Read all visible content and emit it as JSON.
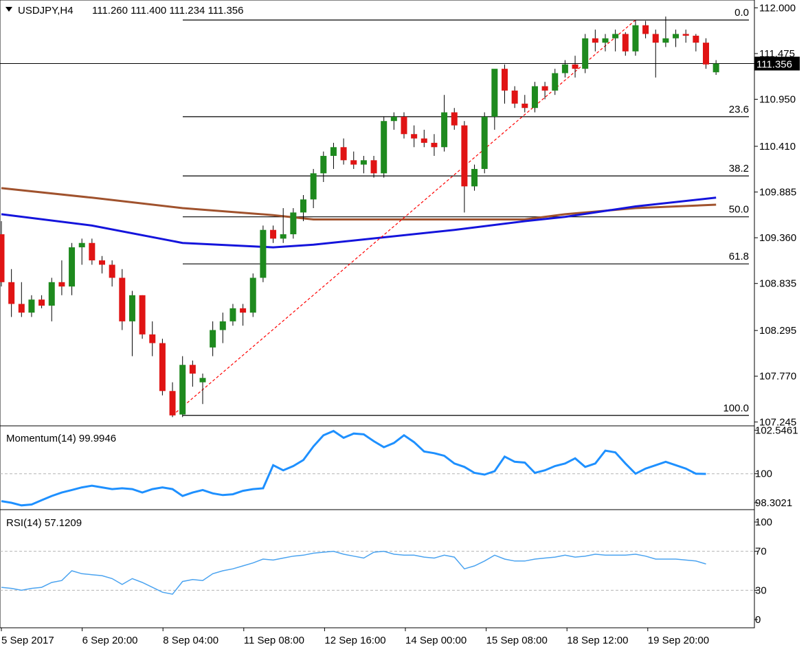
{
  "header": {
    "symbol": "USDJPY,H4",
    "ohlc": "111.260 111.400 111.234 111.356",
    "collapse_icon": "triangle-down-icon"
  },
  "colors": {
    "bull": "#1e8a1e",
    "bear": "#e01414",
    "wick": "#000000",
    "sma_slow": "#a0522d",
    "sma_fast": "#1414dc",
    "fib": "#000000",
    "trend": "#ff0000",
    "momentum": "#1e90ff",
    "rsi": "#4aa3f0",
    "level_line": "#b4b4b4"
  },
  "price_axis": {
    "ticks": [
      "112.000",
      "111.475",
      "110.950",
      "110.410",
      "109.885",
      "109.360",
      "108.835",
      "108.295",
      "107.770",
      "107.245"
    ],
    "current_price": "111.356"
  },
  "time_axis": {
    "labels": [
      "5 Sep 2017",
      "6 Sep 20:00",
      "8 Sep 04:00",
      "11 Sep 08:00",
      "12 Sep 16:00",
      "14 Sep 00:00",
      "15 Sep 08:00",
      "18 Sep 12:00",
      "19 Sep 20:00"
    ]
  },
  "momentum": {
    "title": "Momentum(14) 99.9946",
    "ticks": [
      "102.5461",
      "100",
      "98.3021"
    ]
  },
  "rsi": {
    "title": "RSI(14) 57.1209",
    "ticks": [
      "100",
      "70",
      "30",
      "0"
    ]
  },
  "chart_data": [
    {
      "type": "candlestick",
      "title": "USDJPY,H4",
      "ylim": [
        107.2,
        112.09
      ],
      "fib_levels": [
        {
          "label": "0.0",
          "price": 111.86
        },
        {
          "label": "23.6",
          "price": 110.75
        },
        {
          "label": "38.2",
          "price": 110.07
        },
        {
          "label": "50.0",
          "price": 109.6
        },
        {
          "label": "61.8",
          "price": 109.06
        },
        {
          "label": "100.0",
          "price": 107.32
        }
      ],
      "trendline": {
        "from": {
          "index": 17,
          "price": 107.32
        },
        "to": {
          "index": 63,
          "price": 111.86
        }
      },
      "candles": [
        {
          "o": 109.4,
          "h": 109.55,
          "l": 108.8,
          "c": 108.85
        },
        {
          "o": 108.85,
          "h": 109.0,
          "l": 108.45,
          "c": 108.6
        },
        {
          "o": 108.6,
          "h": 108.85,
          "l": 108.45,
          "c": 108.5
        },
        {
          "o": 108.5,
          "h": 108.7,
          "l": 108.45,
          "c": 108.65
        },
        {
          "o": 108.65,
          "h": 108.7,
          "l": 108.55,
          "c": 108.58
        },
        {
          "o": 108.58,
          "h": 108.9,
          "l": 108.4,
          "c": 108.85
        },
        {
          "o": 108.85,
          "h": 109.1,
          "l": 108.7,
          "c": 108.8
        },
        {
          "o": 108.8,
          "h": 109.3,
          "l": 108.7,
          "c": 109.25
        },
        {
          "o": 109.25,
          "h": 109.35,
          "l": 109.05,
          "c": 109.3
        },
        {
          "o": 109.3,
          "h": 109.35,
          "l": 109.05,
          "c": 109.1
        },
        {
          "o": 109.1,
          "h": 109.15,
          "l": 108.95,
          "c": 109.05
        },
        {
          "o": 109.05,
          "h": 109.1,
          "l": 108.8,
          "c": 108.9
        },
        {
          "o": 108.9,
          "h": 109.0,
          "l": 108.3,
          "c": 108.4
        },
        {
          "o": 108.4,
          "h": 108.75,
          "l": 108.0,
          "c": 108.7
        },
        {
          "o": 108.7,
          "h": 108.7,
          "l": 108.2,
          "c": 108.25
        },
        {
          "o": 108.25,
          "h": 108.4,
          "l": 108.0,
          "c": 108.15
        },
        {
          "o": 108.15,
          "h": 108.2,
          "l": 107.55,
          "c": 107.6
        },
        {
          "o": 107.6,
          "h": 107.7,
          "l": 107.3,
          "c": 107.32
        },
        {
          "o": 107.33,
          "h": 108.0,
          "l": 107.3,
          "c": 107.9
        },
        {
          "o": 107.9,
          "h": 107.95,
          "l": 107.65,
          "c": 107.8
        },
        {
          "o": 107.7,
          "h": 107.8,
          "l": 107.45,
          "c": 107.75
        },
        {
          "o": 108.1,
          "h": 108.4,
          "l": 108.0,
          "c": 108.3
        },
        {
          "o": 108.3,
          "h": 108.5,
          "l": 108.15,
          "c": 108.4
        },
        {
          "o": 108.4,
          "h": 108.6,
          "l": 108.35,
          "c": 108.55
        },
        {
          "o": 108.55,
          "h": 108.6,
          "l": 108.35,
          "c": 108.5
        },
        {
          "o": 108.5,
          "h": 108.95,
          "l": 108.45,
          "c": 108.9
        },
        {
          "o": 108.9,
          "h": 109.5,
          "l": 108.85,
          "c": 109.45
        },
        {
          "o": 109.45,
          "h": 109.5,
          "l": 109.3,
          "c": 109.35
        },
        {
          "o": 109.35,
          "h": 109.7,
          "l": 109.3,
          "c": 109.4
        },
        {
          "o": 109.4,
          "h": 109.7,
          "l": 109.35,
          "c": 109.65
        },
        {
          "o": 109.65,
          "h": 109.85,
          "l": 109.55,
          "c": 109.8
        },
        {
          "o": 109.8,
          "h": 110.15,
          "l": 109.7,
          "c": 110.1
        },
        {
          "o": 110.1,
          "h": 110.35,
          "l": 110.0,
          "c": 110.3
        },
        {
          "o": 110.3,
          "h": 110.45,
          "l": 110.15,
          "c": 110.4
        },
        {
          "o": 110.4,
          "h": 110.5,
          "l": 110.2,
          "c": 110.25
        },
        {
          "o": 110.25,
          "h": 110.35,
          "l": 110.15,
          "c": 110.2
        },
        {
          "o": 110.2,
          "h": 110.3,
          "l": 110.1,
          "c": 110.25
        },
        {
          "o": 110.25,
          "h": 110.3,
          "l": 110.05,
          "c": 110.1
        },
        {
          "o": 110.1,
          "h": 110.75,
          "l": 110.05,
          "c": 110.7
        },
        {
          "o": 110.7,
          "h": 110.8,
          "l": 110.6,
          "c": 110.75
        },
        {
          "o": 110.75,
          "h": 110.8,
          "l": 110.5,
          "c": 110.55
        },
        {
          "o": 110.55,
          "h": 110.65,
          "l": 110.4,
          "c": 110.5
        },
        {
          "o": 110.5,
          "h": 110.6,
          "l": 110.4,
          "c": 110.45
        },
        {
          "o": 110.45,
          "h": 110.55,
          "l": 110.3,
          "c": 110.4
        },
        {
          "o": 110.4,
          "h": 111.0,
          "l": 110.35,
          "c": 110.8
        },
        {
          "o": 110.8,
          "h": 110.85,
          "l": 110.6,
          "c": 110.65
        },
        {
          "o": 110.65,
          "h": 110.7,
          "l": 109.65,
          "c": 109.95
        },
        {
          "o": 109.95,
          "h": 110.2,
          "l": 109.9,
          "c": 110.15
        },
        {
          "o": 110.15,
          "h": 110.8,
          "l": 110.1,
          "c": 110.75
        },
        {
          "o": 110.75,
          "h": 111.15,
          "l": 110.6,
          "c": 111.3
        },
        {
          "o": 111.3,
          "h": 111.35,
          "l": 110.9,
          "c": 111.05
        },
        {
          "o": 111.05,
          "h": 111.1,
          "l": 110.85,
          "c": 110.9
        },
        {
          "o": 110.9,
          "h": 111.0,
          "l": 110.8,
          "c": 110.85
        },
        {
          "o": 110.85,
          "h": 111.15,
          "l": 110.8,
          "c": 111.1
        },
        {
          "o": 111.1,
          "h": 111.15,
          "l": 110.95,
          "c": 111.05
        },
        {
          "o": 111.05,
          "h": 111.3,
          "l": 111.0,
          "c": 111.25
        },
        {
          "o": 111.25,
          "h": 111.4,
          "l": 111.2,
          "c": 111.35
        },
        {
          "o": 111.35,
          "h": 111.45,
          "l": 111.2,
          "c": 111.3
        },
        {
          "o": 111.3,
          "h": 111.7,
          "l": 111.25,
          "c": 111.65
        },
        {
          "o": 111.65,
          "h": 111.75,
          "l": 111.5,
          "c": 111.6
        },
        {
          "o": 111.6,
          "h": 111.7,
          "l": 111.5,
          "c": 111.65
        },
        {
          "o": 111.65,
          "h": 111.75,
          "l": 111.5,
          "c": 111.7
        },
        {
          "o": 111.7,
          "h": 111.72,
          "l": 111.45,
          "c": 111.5
        },
        {
          "o": 111.5,
          "h": 111.86,
          "l": 111.45,
          "c": 111.8
        },
        {
          "o": 111.8,
          "h": 111.85,
          "l": 111.65,
          "c": 111.7
        },
        {
          "o": 111.7,
          "h": 111.75,
          "l": 111.2,
          "c": 111.6
        },
        {
          "o": 111.6,
          "h": 111.9,
          "l": 111.55,
          "c": 111.65
        },
        {
          "o": 111.65,
          "h": 111.75,
          "l": 111.55,
          "c": 111.7
        },
        {
          "o": 111.7,
          "h": 111.75,
          "l": 111.6,
          "c": 111.68
        },
        {
          "o": 111.68,
          "h": 111.7,
          "l": 111.5,
          "c": 111.6
        },
        {
          "o": 111.6,
          "h": 111.65,
          "l": 111.3,
          "c": 111.35
        },
        {
          "o": 111.26,
          "h": 111.4,
          "l": 111.23,
          "c": 111.36
        }
      ],
      "sma_slow": [
        [
          0,
          109.93
        ],
        [
          9,
          109.82
        ],
        [
          18,
          109.7
        ],
        [
          27,
          109.62
        ],
        [
          31,
          109.57
        ],
        [
          45,
          109.57
        ],
        [
          52,
          109.57
        ],
        [
          56,
          109.63
        ],
        [
          63,
          109.7
        ],
        [
          71,
          109.74
        ]
      ],
      "sma_fast": [
        [
          0,
          109.63
        ],
        [
          9,
          109.5
        ],
        [
          18,
          109.3
        ],
        [
          27,
          109.25
        ],
        [
          31,
          109.28
        ],
        [
          45,
          109.45
        ],
        [
          52,
          109.55
        ],
        [
          56,
          109.6
        ],
        [
          63,
          109.72
        ],
        [
          71,
          109.82
        ]
      ]
    },
    {
      "type": "line",
      "title": "Momentum(14) 99.9946",
      "ylim": [
        97.9,
        102.8
      ],
      "reference": 100,
      "values": [
        98.4,
        98.3,
        98.15,
        98.2,
        98.45,
        98.7,
        98.9,
        99.05,
        99.2,
        99.3,
        99.2,
        99.1,
        99.15,
        99.1,
        98.9,
        99.1,
        99.2,
        99.1,
        98.7,
        98.9,
        99.05,
        98.85,
        98.75,
        98.8,
        99.0,
        99.1,
        99.15,
        100.5,
        100.2,
        100.45,
        100.8,
        101.6,
        102.25,
        102.5,
        102.1,
        102.35,
        102.3,
        101.9,
        101.55,
        101.8,
        102.25,
        101.85,
        101.3,
        101.2,
        101.05,
        100.6,
        100.4,
        100.05,
        99.95,
        100.15,
        101.0,
        100.7,
        100.65,
        100.05,
        100.2,
        100.45,
        100.6,
        100.9,
        100.4,
        100.6,
        101.35,
        101.25,
        100.6,
        100.0,
        100.3,
        100.5,
        100.7,
        100.5,
        100.3,
        100.0,
        99.99
      ]
    },
    {
      "type": "line",
      "title": "RSI(14) 57.1209",
      "ylim": [
        0,
        100
      ],
      "levels": [
        70,
        30
      ],
      "values": [
        33,
        32,
        30,
        32,
        33,
        38,
        40,
        50,
        47,
        46,
        45,
        42,
        36,
        42,
        38,
        33,
        28,
        26,
        39,
        41,
        40,
        47,
        50,
        52,
        55,
        58,
        62,
        61,
        63,
        65,
        66,
        68,
        69,
        70,
        67,
        65,
        63,
        69,
        70,
        67,
        66,
        66,
        64,
        63,
        66,
        64,
        52,
        55,
        60,
        66,
        62,
        60,
        60,
        62,
        63,
        64,
        66,
        64,
        65,
        67,
        66,
        66,
        66,
        67,
        65,
        62,
        62,
        62,
        61,
        60,
        57
      ]
    }
  ]
}
